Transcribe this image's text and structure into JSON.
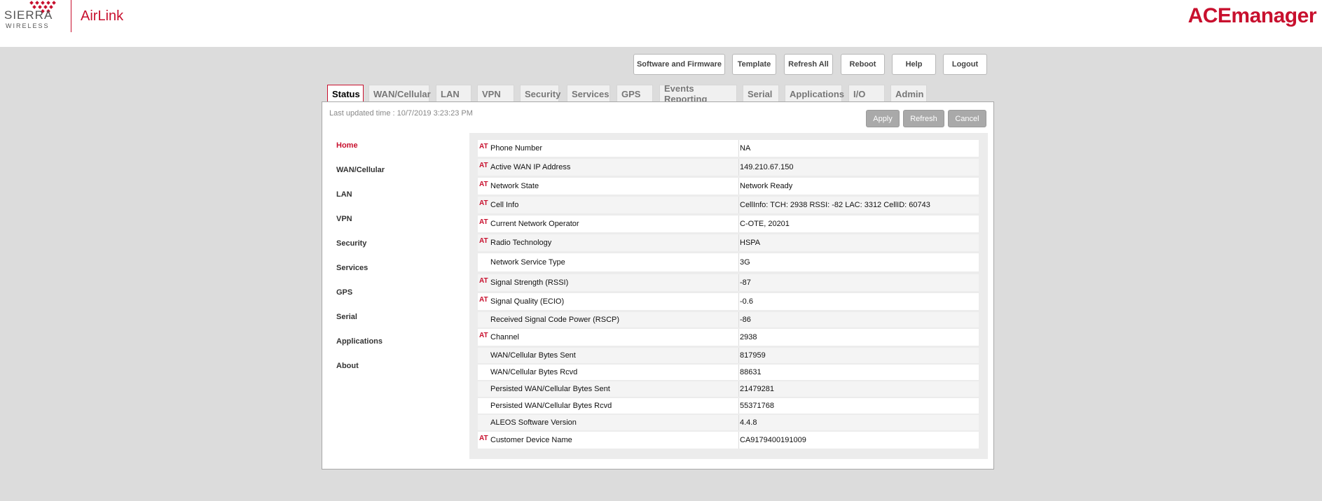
{
  "header": {
    "sierra_text": "SIERRA",
    "wireless_text": "WIRELESS",
    "airlink_text": "AirLink",
    "product_title": "ACEmanager"
  },
  "top_buttons": [
    "Software and Firmware",
    "Template",
    "Refresh All",
    "Reboot",
    "Help",
    "Logout"
  ],
  "tabs": [
    "Status",
    "WAN/Cellular",
    "LAN",
    "VPN",
    "Security",
    "Services",
    "GPS",
    "Events Reporting",
    "Serial",
    "Applications",
    "I/O",
    "Admin"
  ],
  "active_tab": "Status",
  "last_updated": "Last updated time : 10/7/2019 3:23:23 PM",
  "actions": {
    "apply": "Apply",
    "refresh": "Refresh",
    "cancel": "Cancel"
  },
  "sidebar": [
    "Home",
    "WAN/Cellular",
    "LAN",
    "VPN",
    "Security",
    "Services",
    "GPS",
    "Serial",
    "Applications",
    "About"
  ],
  "active_sidebar": "Home",
  "at_marker": "AT",
  "rows": [
    {
      "label": "Phone Number",
      "value": "NA",
      "at": true
    },
    {
      "label": "Active WAN IP Address",
      "value": "149.210.67.150",
      "at": true
    },
    {
      "label": "Network State",
      "value": "Network Ready",
      "at": true
    },
    {
      "label": "Cell Info",
      "value": "CellInfo: TCH: 2938 RSSI: -82 LAC: 3312 CellID: 60743",
      "at": true
    },
    {
      "label": "Current Network Operator",
      "value": "C-OTE, 20201",
      "at": true
    },
    {
      "label": "Radio Technology",
      "value": "HSPA",
      "at": true
    },
    {
      "label": "Network Service Type",
      "value": "3G",
      "at": false
    },
    {
      "label": "Signal Strength (RSSI)",
      "value": "-87",
      "at": true
    },
    {
      "label": "Signal Quality (ECIO)",
      "value": "-0.6",
      "at": true
    },
    {
      "label": "Received Signal Code Power (RSCP)",
      "value": "-86",
      "at": false
    },
    {
      "label": "Channel",
      "value": "2938",
      "at": true
    },
    {
      "label": "WAN/Cellular Bytes Sent",
      "value": "817959",
      "at": false
    },
    {
      "label": "WAN/Cellular Bytes Rcvd",
      "value": "88631",
      "at": false
    },
    {
      "label": "Persisted WAN/Cellular Bytes Sent",
      "value": "21479281",
      "at": false
    },
    {
      "label": "Persisted WAN/Cellular Bytes Rcvd",
      "value": "55371768",
      "at": false
    },
    {
      "label": "ALEOS Software Version",
      "value": "4.4.8",
      "at": false
    },
    {
      "label": "Customer Device Name",
      "value": "CA9179400191009",
      "at": true
    }
  ],
  "colors": {
    "brand_red": "#c8102e",
    "page_bg": "#dcdcdc",
    "button_gray": "#a9a9a9"
  }
}
